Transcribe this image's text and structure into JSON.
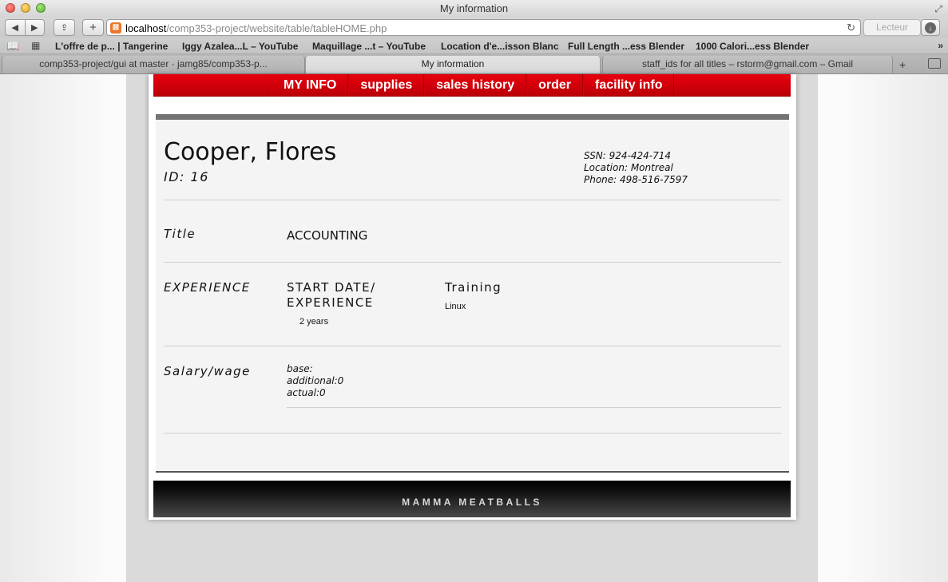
{
  "browser": {
    "window_title": "My information",
    "url_host": "localhost",
    "url_path": "/comp353-project/website/table/tableHOME.php",
    "reader_label": "Lecteur",
    "bookmarks": [
      "L'offre de p... | Tangerine",
      "Iggy Azalea...L – YouTube",
      "Maquillage ...t – YouTube",
      "Location d'e...isson Blanc",
      "Full Length ...ess Blender",
      "1000 Calori...ess Blender"
    ],
    "tabs": [
      "comp353-project/gui at master · jamg85/comp353-p...",
      "My information",
      "staff_ids for all titles – rstorm@gmail.com – Gmail"
    ]
  },
  "nav": {
    "items": [
      "MY INFO",
      "supplies",
      "sales history",
      "order",
      "facility info"
    ]
  },
  "profile": {
    "name": "Cooper, Flores",
    "id_line": "ID: 16",
    "ssn": "SSN: 924-424-714",
    "location": "Location: Montreal",
    "phone": "Phone: 498-516-7597"
  },
  "title_section": {
    "label": "Title",
    "value": "ACCOUNTING"
  },
  "experience_section": {
    "label": "EXPERIENCE",
    "start_header_line1": "START DATE/",
    "start_header_line2": "EXPERIENCE",
    "experience_value": "2 years",
    "training_header": "Training",
    "training_value": "Linux"
  },
  "salary_section": {
    "label": "Salary/wage",
    "base": "base:",
    "additional": "additional:0",
    "actual": "actual:0"
  },
  "footer": {
    "text": "MAMMA MEATBALLS"
  }
}
